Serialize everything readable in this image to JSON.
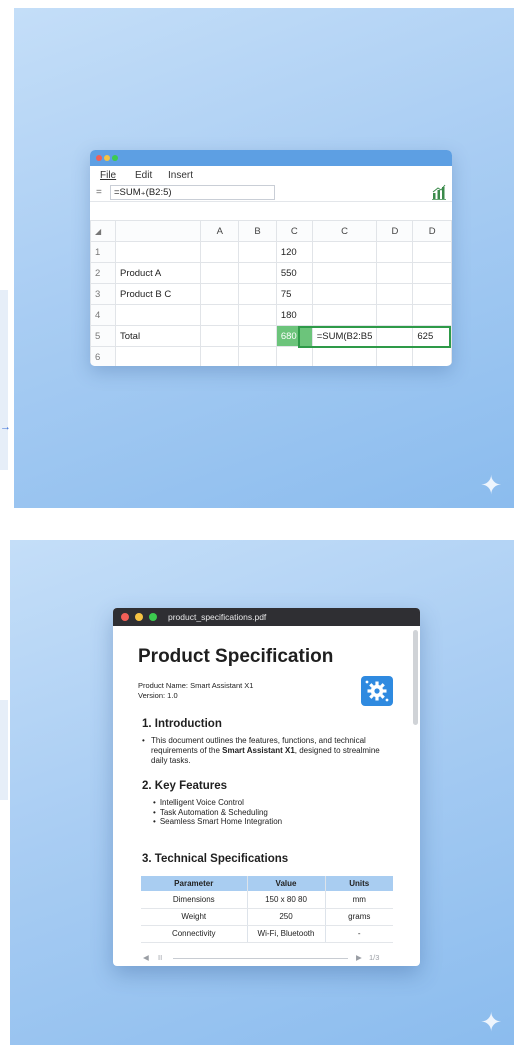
{
  "spreadsheet": {
    "menus": [
      "File",
      "Edit",
      "Insert"
    ],
    "fx_label": "=",
    "formula": "=SUM₊(B2:5)",
    "icons": {
      "chart": "bar-chart-icon"
    },
    "columns": [
      "A",
      "B",
      "C",
      "C",
      "D",
      "D"
    ],
    "rows": [
      {
        "num": "1",
        "label": "",
        "c": "120",
        "c2": "",
        "d": "",
        "d2": ""
      },
      {
        "num": "2",
        "label": "Product A",
        "c": "550",
        "c2": "",
        "d": "",
        "d2": ""
      },
      {
        "num": "3",
        "label": "Product B C",
        "c": "75",
        "c2": "",
        "d": "",
        "d2": ""
      },
      {
        "num": "4",
        "label": "",
        "c": "180",
        "c2": "",
        "d": "",
        "d2": ""
      },
      {
        "num": "5",
        "label": "Total",
        "c": "680",
        "c2": "=SUM(B2:B5",
        "d": "",
        "d2": "625"
      },
      {
        "num": "6",
        "label": "",
        "c": "",
        "c2": "",
        "d": "",
        "d2": ""
      }
    ],
    "colors": {
      "titlebar": "#5d9fe3",
      "selection": "#6cc47b",
      "outline": "#2e9a48"
    }
  },
  "pdf": {
    "filename": "product_specifications.pdf",
    "title": "Product Specification",
    "product_name": "Product Name: Smart Assistant X1",
    "version": "Version: 1.0",
    "intro": {
      "heading": "1. Introduction",
      "text_before": "This document outlines the features, functions, and technical requirements of the ",
      "bold": "Smart Assistant X1",
      "text_after": ", designed to strealmine daily tasks."
    },
    "features": {
      "heading": "2. Key Features",
      "items": [
        "Intelligent Voice Control",
        "Task Automation & Scheduling",
        "Seamless Smart Home Integration"
      ]
    },
    "specs": {
      "heading": "3. Technical Specifications",
      "columns": [
        "Parameter",
        "Value",
        "Units"
      ],
      "rows": [
        [
          "Dimensions",
          "150 x 80 80",
          "mm"
        ],
        [
          "Weight",
          "250",
          "grams"
        ],
        [
          "Connectivity",
          "Wi-Fi, Bluetooth",
          "-"
        ]
      ]
    },
    "footer": {
      "prev": "◀",
      "pause": "II",
      "next": "▶",
      "page": "1/3"
    },
    "icons": {
      "badge": "gear-icon"
    },
    "colors": {
      "badge": "#2f8ae0",
      "table_header": "#a9cdf1",
      "titlebar": "#2f2f33"
    }
  },
  "decorations": {
    "sparkle": "✦",
    "edge_arrow": "→"
  }
}
